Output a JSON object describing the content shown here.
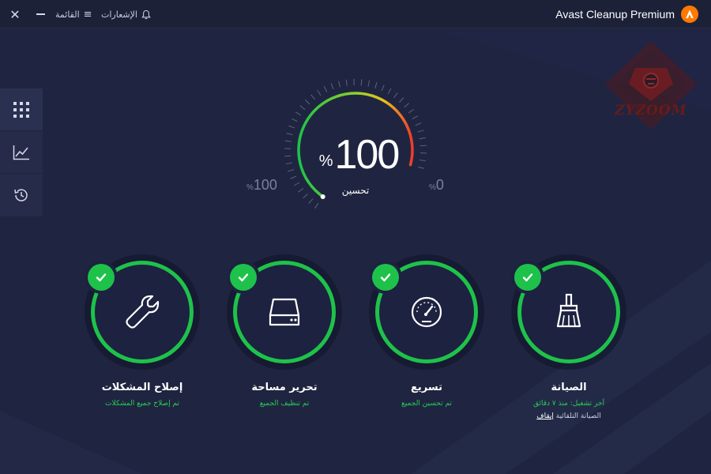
{
  "titlebar": {
    "app_title": "Avast Cleanup Premium",
    "menu_label": "القائمة",
    "notifications_label": "الإشعارات",
    "close_symbol": "✕",
    "menu_icon": "≡"
  },
  "sidebar": {
    "items": [
      {
        "icon": "grid-icon"
      },
      {
        "icon": "chart-icon"
      },
      {
        "icon": "history-icon"
      }
    ]
  },
  "watermark": {
    "text": "ZYZOOM"
  },
  "gauge": {
    "value": "100",
    "percent_sign": "%",
    "label": "تحسين",
    "left_label": "100",
    "right_label": "0",
    "scale_percent": "%",
    "fill_fraction": 1.0
  },
  "cards": [
    {
      "title": "إصلاح المشكلات",
      "subtitle": "تم إصلاح جميع المشكلات",
      "icon": "wrench-icon"
    },
    {
      "title": "تحرير مساحة",
      "subtitle": "تم تنظيف الجميع",
      "icon": "hard-drive-icon"
    },
    {
      "title": "تسريع",
      "subtitle": "تم تحسين الجميع",
      "icon": "speedometer-icon"
    },
    {
      "title": "الصيانة",
      "subtitle": "آخر تشغيل: منذ ٧ دقائق",
      "extra_text": "الصيانة التلقائية",
      "extra_link": "إيقاف",
      "icon": "broom-icon"
    }
  ],
  "colors": {
    "background": "#1f2540",
    "accent_green": "#1ec24a",
    "brand_orange": "#ff7800"
  }
}
